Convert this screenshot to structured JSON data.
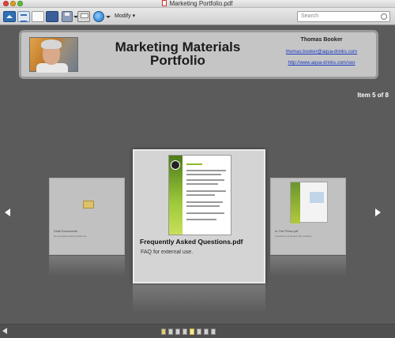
{
  "window": {
    "title": "Marketing Portfolio.pdf"
  },
  "toolbar": {
    "modify_label": "Modify",
    "search_placeholder": "Search"
  },
  "header": {
    "title_line1": "Marketing Materials",
    "title_line2": "Portfolio",
    "contact_name": "Thomas Booker",
    "email": "thomas.booker@aqua-drinks.com",
    "website": "http://www.aqua-drinks.com/seo"
  },
  "navigation": {
    "item_counter": "Item 5 of 8"
  },
  "carousel": {
    "current": {
      "title": "Frequently Asked Questions.pdf",
      "description": "FAQ for external use."
    },
    "previous": {
      "label": "Draft Documents",
      "description": "Not yet approved for public use"
    },
    "next": {
      "label": "In The Press.pdf",
      "description": "A selection of articles from industry"
    }
  },
  "pager": {
    "count": 8,
    "active_index": 4
  },
  "colors": {
    "background": "#5b5b5b",
    "link": "#1a3cc4",
    "accent_green": "#9ec93a"
  }
}
